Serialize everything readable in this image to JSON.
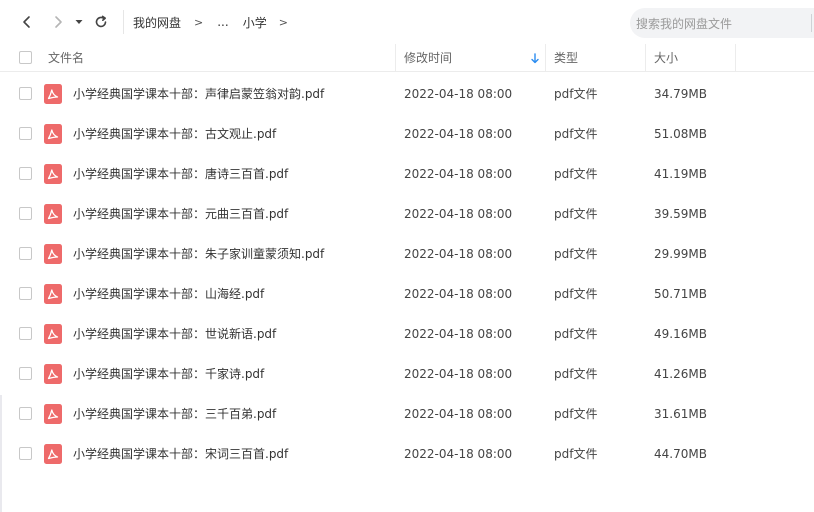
{
  "toolbar": {
    "back_icon": "chevron-left-icon",
    "forward_icon": "chevron-right-icon",
    "history_icon": "caret-down-icon",
    "refresh_icon": "refresh-icon",
    "breadcrumb": {
      "root": "我的网盘",
      "separator": ">",
      "ellipsis": "...",
      "current": "小学"
    },
    "search": {
      "placeholder": "搜索我的网盘文件"
    }
  },
  "table": {
    "columns": {
      "name": "文件名",
      "modified": "修改时间",
      "type": "类型",
      "size": "大小"
    },
    "sort_icon": "sort-down-arrow-icon",
    "accent_color": "#2b8cf0",
    "file_icon_color": "#ee6a6a",
    "rows": [
      {
        "name": "小学经典国学课本十部：声律启蒙笠翁对韵.pdf",
        "modified": "2022-04-18 08:00",
        "type": "pdf文件",
        "size": "34.79MB"
      },
      {
        "name": "小学经典国学课本十部：古文观止.pdf",
        "modified": "2022-04-18 08:00",
        "type": "pdf文件",
        "size": "51.08MB"
      },
      {
        "name": "小学经典国学课本十部：唐诗三百首.pdf",
        "modified": "2022-04-18 08:00",
        "type": "pdf文件",
        "size": "41.19MB"
      },
      {
        "name": "小学经典国学课本十部：元曲三百首.pdf",
        "modified": "2022-04-18 08:00",
        "type": "pdf文件",
        "size": "39.59MB"
      },
      {
        "name": "小学经典国学课本十部：朱子家训童蒙须知.pdf",
        "modified": "2022-04-18 08:00",
        "type": "pdf文件",
        "size": "29.99MB"
      },
      {
        "name": "小学经典国学课本十部：山海经.pdf",
        "modified": "2022-04-18 08:00",
        "type": "pdf文件",
        "size": "50.71MB"
      },
      {
        "name": "小学经典国学课本十部：世说新语.pdf",
        "modified": "2022-04-18 08:00",
        "type": "pdf文件",
        "size": "49.16MB"
      },
      {
        "name": "小学经典国学课本十部：千家诗.pdf",
        "modified": "2022-04-18 08:00",
        "type": "pdf文件",
        "size": "41.26MB"
      },
      {
        "name": "小学经典国学课本十部：三千百弟.pdf",
        "modified": "2022-04-18 08:00",
        "type": "pdf文件",
        "size": "31.61MB"
      },
      {
        "name": "小学经典国学课本十部：宋词三百首.pdf",
        "modified": "2022-04-18 08:00",
        "type": "pdf文件",
        "size": "44.70MB"
      }
    ]
  }
}
